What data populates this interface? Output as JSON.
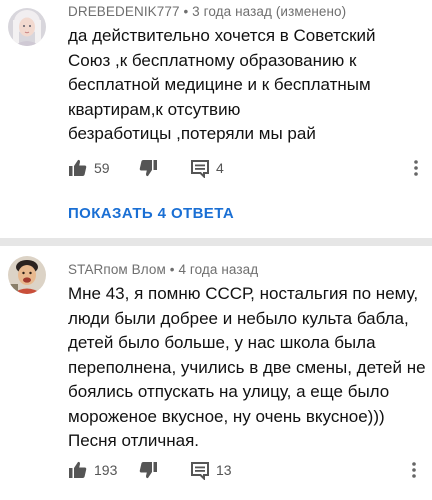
{
  "comments": [
    {
      "author": "DREBEDENIK777",
      "time": "3 года назад (изменено)",
      "text_lines": [
        "да действительно хочется в Советский",
        "Союз ,к бесплатному образованию к",
        "бесплатной медицине и к бесплатным",
        "квартирам,к отсутвию",
        "безработицы ,потеряли мы рай"
      ],
      "likes": "59",
      "replies_count": "4",
      "show_replies_label": "ПОКАЗАТЬ 4 ОТВЕТА"
    },
    {
      "author": "STARпом Влом",
      "time": "4 года назад",
      "text_lines": [
        "Мне 43, я помню СССР, ностальгия по нему,",
        "люди были добрее и небыло культа бабла,",
        "детей было больше, у нас школа была",
        "переполнена, учились в две смены, детей не",
        "боялись отпускать на улицу, а еще было",
        "мороженое вкусное, ну очень вкусное)))",
        "Песня отличная."
      ],
      "likes": "193",
      "replies_count": "13"
    }
  ],
  "separator": "•",
  "icons": {
    "like": "thumbs-up-icon",
    "dislike": "thumbs-down-icon",
    "reply": "reply-comment-icon",
    "more": "more-vertical-icon"
  },
  "colors": {
    "link": "#1a6fd4",
    "meta": "#6f6f6f",
    "divider": "#e6e6e6"
  }
}
